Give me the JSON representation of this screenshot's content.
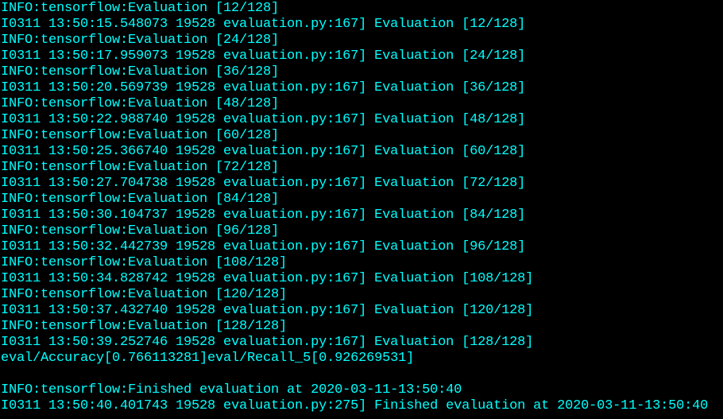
{
  "terminal": {
    "colors": {
      "background": "#000000",
      "text": "#00ffff"
    },
    "lines": [
      "INFO:tensorflow:Evaluation [12/128]",
      "I0311 13:50:15.548073 19528 evaluation.py:167] Evaluation [12/128]",
      "INFO:tensorflow:Evaluation [24/128]",
      "I0311 13:50:17.959073 19528 evaluation.py:167] Evaluation [24/128]",
      "INFO:tensorflow:Evaluation [36/128]",
      "I0311 13:50:20.569739 19528 evaluation.py:167] Evaluation [36/128]",
      "INFO:tensorflow:Evaluation [48/128]",
      "I0311 13:50:22.988740 19528 evaluation.py:167] Evaluation [48/128]",
      "INFO:tensorflow:Evaluation [60/128]",
      "I0311 13:50:25.366740 19528 evaluation.py:167] Evaluation [60/128]",
      "INFO:tensorflow:Evaluation [72/128]",
      "I0311 13:50:27.704738 19528 evaluation.py:167] Evaluation [72/128]",
      "INFO:tensorflow:Evaluation [84/128]",
      "I0311 13:50:30.104737 19528 evaluation.py:167] Evaluation [84/128]",
      "INFO:tensorflow:Evaluation [96/128]",
      "I0311 13:50:32.442739 19528 evaluation.py:167] Evaluation [96/128]",
      "INFO:tensorflow:Evaluation [108/128]",
      "I0311 13:50:34.828742 19528 evaluation.py:167] Evaluation [108/128]",
      "INFO:tensorflow:Evaluation [120/128]",
      "I0311 13:50:37.432740 19528 evaluation.py:167] Evaluation [120/128]",
      "INFO:tensorflow:Evaluation [128/128]",
      "I0311 13:50:39.252746 19528 evaluation.py:167] Evaluation [128/128]",
      "eval/Accuracy[0.766113281]eval/Recall_5[0.926269531]",
      "",
      "INFO:tensorflow:Finished evaluation at 2020-03-11-13:50:40",
      "I0311 13:50:40.401743 19528 evaluation.py:275] Finished evaluation at 2020-03-11-13:50:40"
    ]
  }
}
